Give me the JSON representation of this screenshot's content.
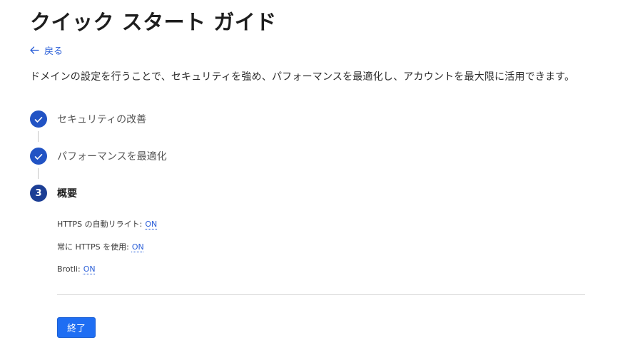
{
  "page": {
    "title": "クイック スタート ガイド",
    "back_label": "戻る",
    "description": "ドメインの設定を行うことで、セキュリティを強め、パフォーマンスを最適化し、アカウントを最大限に活用できます。"
  },
  "steps": [
    {
      "label": "セキュリティの改善",
      "status": "completed"
    },
    {
      "label": "パフォーマンスを最適化",
      "status": "completed"
    },
    {
      "number": "3",
      "label": "概要",
      "status": "current"
    }
  ],
  "summary": {
    "settings": [
      {
        "label": "HTTPS の自動リライト:",
        "value": "ON"
      },
      {
        "label": "常に HTTPS を使用:",
        "value": "ON"
      },
      {
        "label": "Brotli:",
        "value": "ON"
      }
    ]
  },
  "actions": {
    "finish_label": "終了"
  },
  "icons": {
    "back": "arrow-left-icon",
    "completed_step": "checkmark-icon"
  },
  "colors": {
    "accent": "#1f6ef3",
    "link": "#2b5fd8",
    "step_complete": "#2153c4",
    "step_current": "#1d3f95"
  }
}
